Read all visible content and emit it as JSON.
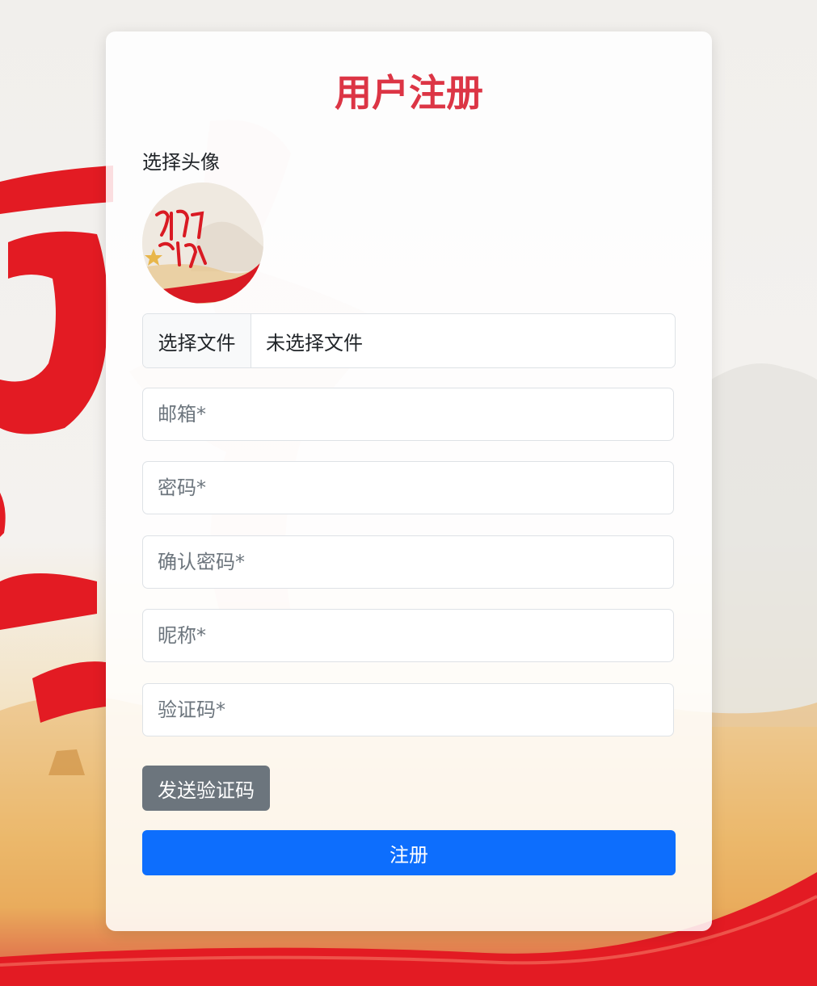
{
  "form": {
    "title": "用户注册",
    "avatar_label": "选择头像",
    "file_button_label": "选择文件",
    "file_status": "未选择文件",
    "email_placeholder": "邮箱*",
    "password_placeholder": "密码*",
    "confirm_password_placeholder": "确认密码*",
    "nickname_placeholder": "昵称*",
    "code_placeholder": "验证码*",
    "send_code_label": "发送验证码",
    "submit_label": "注册"
  },
  "colors": {
    "title": "#dc3545",
    "primary": "#0d6efd",
    "secondary": "#6c757d",
    "background_red": "#e31b23"
  }
}
